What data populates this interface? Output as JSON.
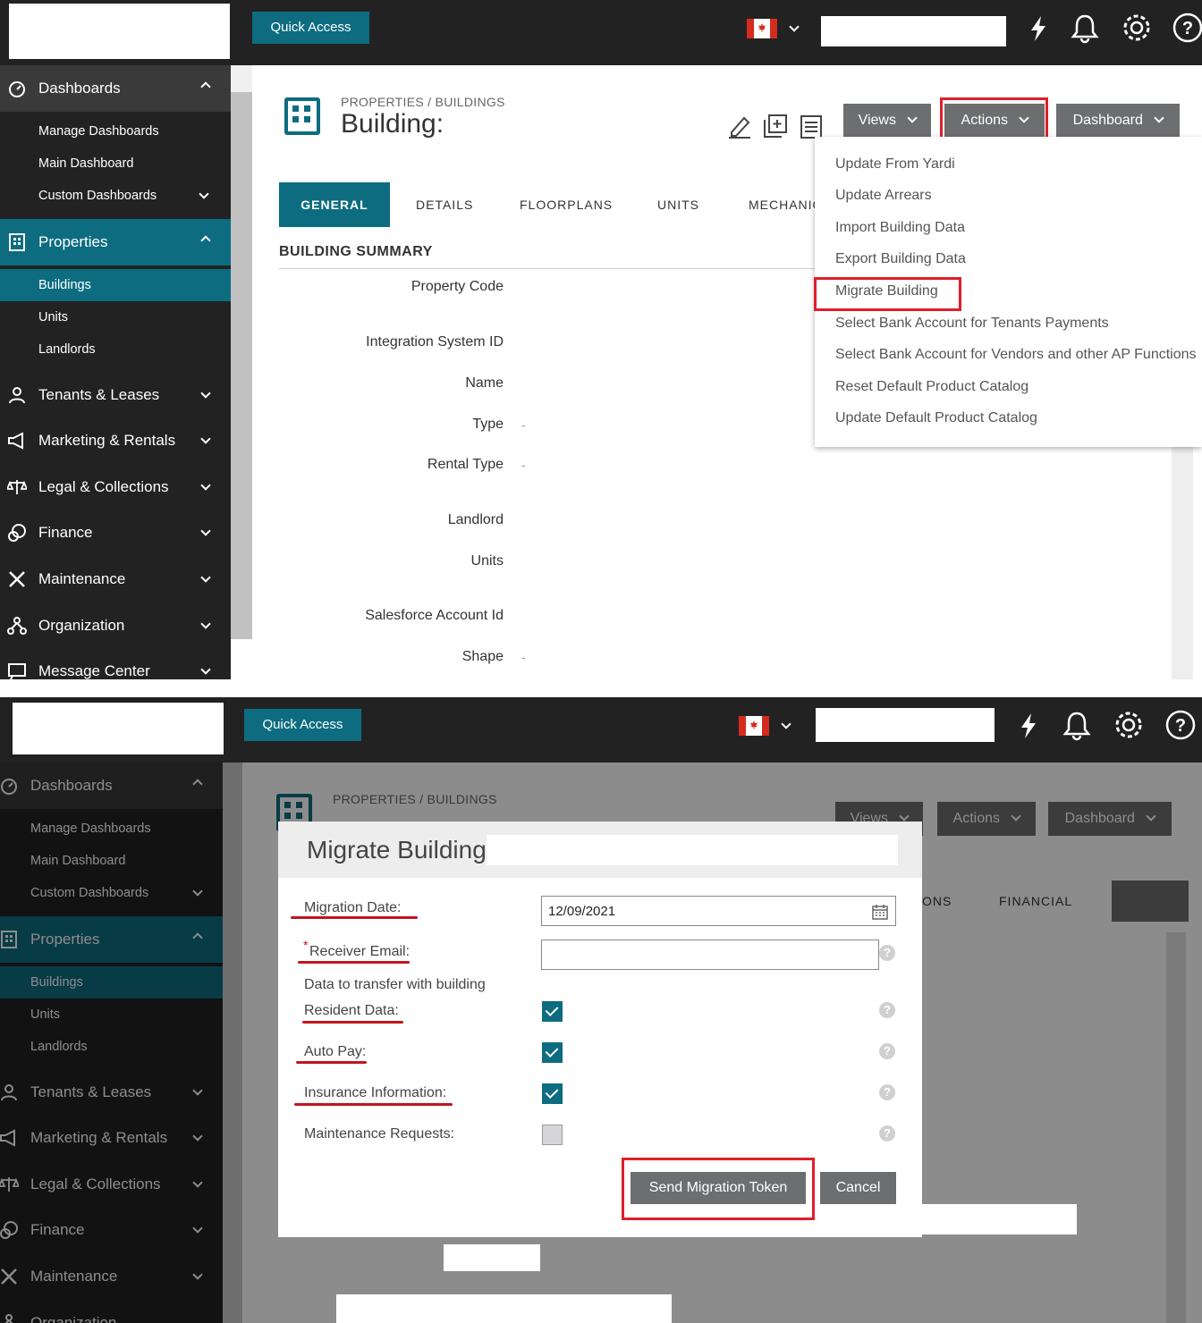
{
  "topbar": {
    "quick_access": "Quick Access"
  },
  "sidebar": {
    "dashboards": "Dashboards",
    "manage_dashboards": "Manage Dashboards",
    "main_dashboard": "Main Dashboard",
    "custom_dashboards": "Custom Dashboards",
    "properties": "Properties",
    "buildings": "Buildings",
    "units": "Units",
    "landlords": "Landlords",
    "tenants_leases": "Tenants & Leases",
    "marketing_rentals": "Marketing & Rentals",
    "legal_collections": "Legal & Collections",
    "finance": "Finance",
    "maintenance": "Maintenance",
    "organization": "Organization",
    "message_center": "Message Center"
  },
  "page": {
    "breadcrumb": "PROPERTIES / BUILDINGS",
    "title": "Building:",
    "views_btn": "Views",
    "actions_btn": "Actions",
    "dashboard_btn": "Dashboard",
    "tabs": [
      "GENERAL",
      "DETAILS",
      "FLOORPLANS",
      "UNITS",
      "MECHANIC"
    ],
    "tabs2": [
      "ONS",
      "FINANCIAL"
    ],
    "section_title": "BUILDING SUMMARY",
    "fields": [
      "Property Code",
      "Integration System ID",
      "Name",
      "Type",
      "Rental Type",
      "Landlord",
      "Units",
      "Salesforce Account Id",
      "Shape"
    ],
    "empty_value": "-"
  },
  "actions_menu": [
    "Update From Yardi",
    "Update Arrears",
    "Import Building Data",
    "Export Building Data",
    "Migrate Building",
    "Select Bank Account for Tenants Payments",
    "Select Bank Account for Vendors and other AP Functions",
    "Reset Default Product Catalog",
    "Update Default Product Catalog"
  ],
  "modal": {
    "title": "Migrate Building",
    "migration_date_label": "Migration Date:",
    "migration_date_value": "12/09/2021",
    "receiver_email_label": "Receiver Email:",
    "required_mark": "*",
    "transfer_heading": "Data to transfer with building",
    "resident_data_label": "Resident Data:",
    "auto_pay_label": "Auto Pay:",
    "insurance_label": "Insurance Information:",
    "maintenance_label": "Maintenance Requests:",
    "resident_data_checked": true,
    "auto_pay_checked": true,
    "insurance_checked": true,
    "maintenance_checked": false,
    "help_glyph": "?",
    "send_btn": "Send Migration Token",
    "cancel_btn": "Cancel"
  },
  "colors": {
    "accent": "#0d6c80",
    "dark": "#222222",
    "button": "#6d6e70",
    "highlight": "#e01e2b"
  }
}
